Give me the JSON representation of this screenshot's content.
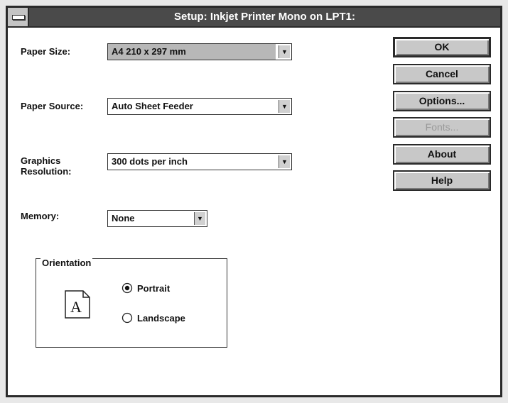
{
  "window": {
    "title": "Setup: Inkjet Printer Mono on LPT1:"
  },
  "fields": {
    "paper_size_label": "Paper Size:",
    "paper_size_value": "A4 210 x 297 mm",
    "paper_source_label": "Paper Source:",
    "paper_source_value": "Auto Sheet Feeder",
    "graphics_resolution_label_line1": "Graphics",
    "graphics_resolution_label_line2": "Resolution:",
    "graphics_resolution_value": "300 dots per inch",
    "memory_label": "Memory:",
    "memory_value": "None"
  },
  "orientation": {
    "group_label": "Orientation",
    "icon_letter": "A",
    "portrait_label": "Portrait",
    "landscape_label": "Landscape",
    "selected": "Portrait"
  },
  "buttons": {
    "ok": "OK",
    "cancel": "Cancel",
    "options": "Options...",
    "fonts": "Fonts...",
    "about": "About",
    "help": "Help"
  },
  "icons": {
    "dropdown_arrow": "down-arrow-icon",
    "system_menu": "system-menu-icon",
    "document": "document-portrait-icon"
  },
  "colors": {
    "titlebar": "#4a4a4a",
    "button_face": "#c8c8c8",
    "disabled_text": "#9a9a9a"
  }
}
